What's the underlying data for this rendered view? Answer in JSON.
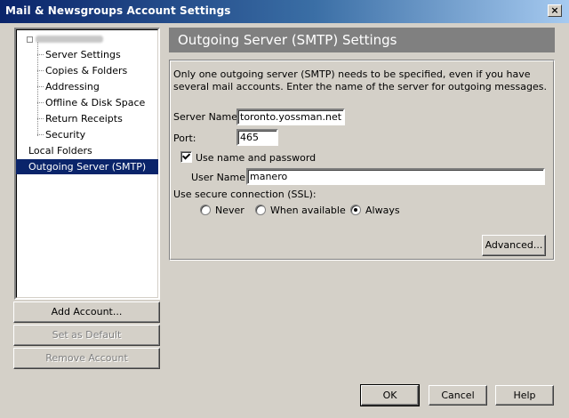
{
  "window": {
    "title": "Mail & Newsgroups Account Settings",
    "close_glyph": "×"
  },
  "tree": {
    "items": [
      {
        "label": "Server Settings"
      },
      {
        "label": "Copies & Folders"
      },
      {
        "label": "Addressing"
      },
      {
        "label": "Offline & Disk Space"
      },
      {
        "label": "Return Receipts"
      },
      {
        "label": "Security"
      },
      {
        "label": "Local Folders"
      },
      {
        "label": "Outgoing Server (SMTP)"
      }
    ]
  },
  "left_buttons": {
    "add_account": "Add Account...",
    "set_default": "Set as Default",
    "remove_account": "Remove Account"
  },
  "smtp": {
    "header": "Outgoing Server (SMTP) Settings",
    "description": "Only one outgoing server (SMTP) needs to be specified, even if you have several mail accounts. Enter the name of the server for outgoing messages.",
    "server_name_label": "Server Name:",
    "server_name_value": "toronto.yossman.net",
    "port_label": "Port:",
    "port_value": "465",
    "use_name_password_label": "Use name and password",
    "use_name_password_checked": true,
    "user_name_label": "User Name:",
    "user_name_value": "manero",
    "ssl_label": "Use secure connection (SSL):",
    "ssl_options": [
      "Never",
      "When available",
      "Always"
    ],
    "ssl_selected": "Always",
    "advanced_button": "Advanced..."
  },
  "footer": {
    "ok": "OK",
    "cancel": "Cancel",
    "help": "Help"
  }
}
